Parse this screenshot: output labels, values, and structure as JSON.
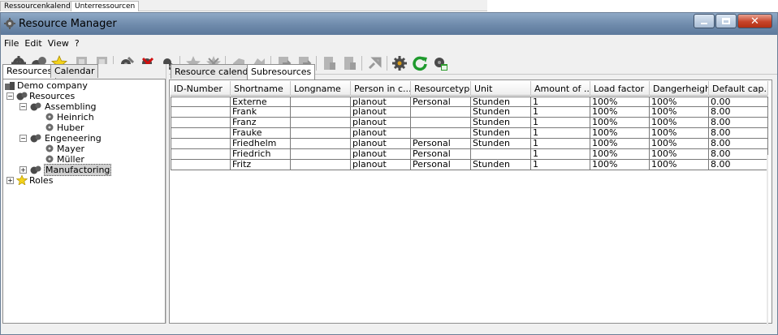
{
  "background_tabs": [
    "Ressourcenkalender",
    "Unterressourcen"
  ],
  "window": {
    "title": "Resource Manager",
    "controls": [
      "minimize-icon",
      "maximize-icon",
      "close-icon"
    ]
  },
  "menu": [
    "File",
    "Edit",
    "View",
    "?"
  ],
  "toolbar": {
    "icons": [
      "new-resource-icon",
      "add-subresource-icon",
      "star-favorite-icon",
      "doc-gray-icon",
      "doc2-gray-icon",
      "edit-resource-icon",
      "delete-resource-icon",
      "resource-settings-icon",
      "star-gray-icon",
      "star-delete-gray-icon",
      "clipboard-gray-icon",
      "clipboard2-gray-icon",
      "export-gray-icon",
      "export2-gray-icon",
      "print-gray-icon",
      "print2-gray-icon",
      "link-gray-icon",
      "gear-icon",
      "refresh-icon",
      "calendar-resource-icon"
    ]
  },
  "left_tabs": [
    "Resources",
    "Calendar"
  ],
  "tree": {
    "root": "Demo company",
    "resources": "Resources",
    "groups": [
      {
        "name": "Assembling",
        "children": [
          "Heinrich",
          "Huber"
        ]
      },
      {
        "name": "Engeneering",
        "children": [
          "Mayer",
          "Müller"
        ]
      },
      {
        "name": "Manufactoring",
        "children": []
      }
    ],
    "roles": "Roles"
  },
  "right_tabs": [
    "Resource calendar",
    "Subresources"
  ],
  "table": {
    "columns": [
      "ID-Number",
      "Shortname",
      "Longname",
      "Person in c...",
      "Resourcetype",
      "Unit",
      "Amount of ...",
      "Load factor",
      "Dangerheight",
      "Default cap..."
    ],
    "rows": [
      [
        "",
        "Externe",
        "",
        "planout",
        "Personal",
        "Stunden",
        "1",
        "100%",
        "100%",
        "0.00"
      ],
      [
        "",
        "Frank",
        "",
        "planout",
        "",
        "Stunden",
        "1",
        "100%",
        "100%",
        "8.00"
      ],
      [
        "",
        "Franz",
        "",
        "planout",
        "",
        "Stunden",
        "1",
        "100%",
        "100%",
        "8.00"
      ],
      [
        "",
        "Frauke",
        "",
        "planout",
        "",
        "Stunden",
        "1",
        "100%",
        "100%",
        "8.00"
      ],
      [
        "",
        "Friedhelm",
        "",
        "planout",
        "Personal",
        "Stunden",
        "1",
        "100%",
        "100%",
        "8.00"
      ],
      [
        "",
        "Friedrich",
        "",
        "planout",
        "Personal",
        "",
        "1",
        "100%",
        "100%",
        "8.00"
      ],
      [
        "",
        "Fritz",
        "",
        "planout",
        "Personal",
        "Stunden",
        "1",
        "100%",
        "100%",
        "8.00"
      ]
    ]
  }
}
